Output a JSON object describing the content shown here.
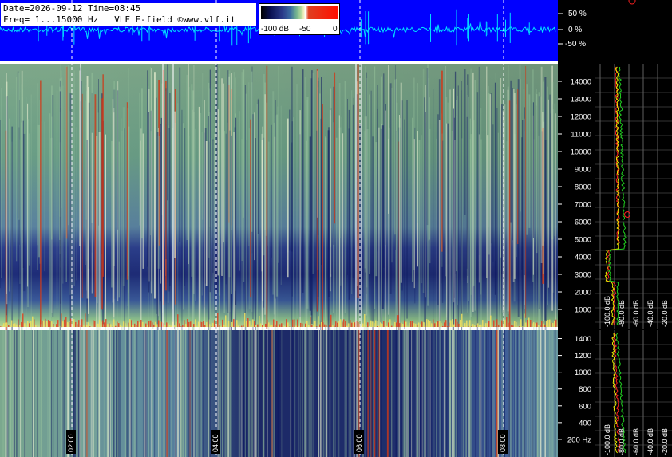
{
  "header": {
    "line1": "Date=2026-09-12 Time=08:45",
    "line2": "Freq= 1...15000 Hz   VLF E-field ©www.vlf.it"
  },
  "colorbar": {
    "tick_labels": [
      "-100 dB",
      "-50",
      "0"
    ],
    "colors": [
      "#000000",
      "#2a3a8a",
      "#70b090",
      "#ffffff",
      "#ff1000"
    ]
  },
  "chart_data": [
    {
      "type": "line",
      "name": "waveform",
      "ylabels": [
        "50 %",
        "0 %",
        "-50 %"
      ],
      "y_values": [
        50,
        0,
        -50
      ],
      "colors": {
        "background": "#0000ff",
        "trace": "#00e0ff"
      }
    },
    {
      "type": "heatmap",
      "name": "spectrogram-upper",
      "yticks": [
        1000,
        2000,
        3000,
        4000,
        5000,
        6000,
        7000,
        8000,
        9000,
        10000,
        11000,
        12000,
        13000,
        14000
      ],
      "ylim": [
        0,
        15000
      ],
      "time_labels": [
        "02:00",
        "04:00",
        "06:00",
        "08:00"
      ]
    },
    {
      "type": "heatmap",
      "name": "spectrogram-lower",
      "yticks": [
        "200 Hz",
        "400",
        "600",
        "800",
        "1000",
        "1200",
        "1400"
      ],
      "ylim": [
        0,
        1500
      ],
      "time_labels": [
        "02:00",
        "04:00",
        "06:00",
        "08:00"
      ]
    },
    {
      "type": "line",
      "name": "spectrum-upper",
      "xlabels": [
        "-100.0 dB",
        "-80.0 dB",
        "-60.0 dB",
        "-40.0 dB",
        "-20.0 dB"
      ],
      "series_colors": [
        "#ff2020",
        "#f0f000",
        "#20d020"
      ]
    },
    {
      "type": "line",
      "name": "spectrum-lower",
      "xlabels": [
        "-100.0 dB",
        "-80.0 dB",
        "-60.0 dB",
        "-40.0 dB",
        "-20.0 dB"
      ],
      "series_colors": [
        "#ff2020",
        "#f0f000",
        "#20d020"
      ]
    }
  ]
}
